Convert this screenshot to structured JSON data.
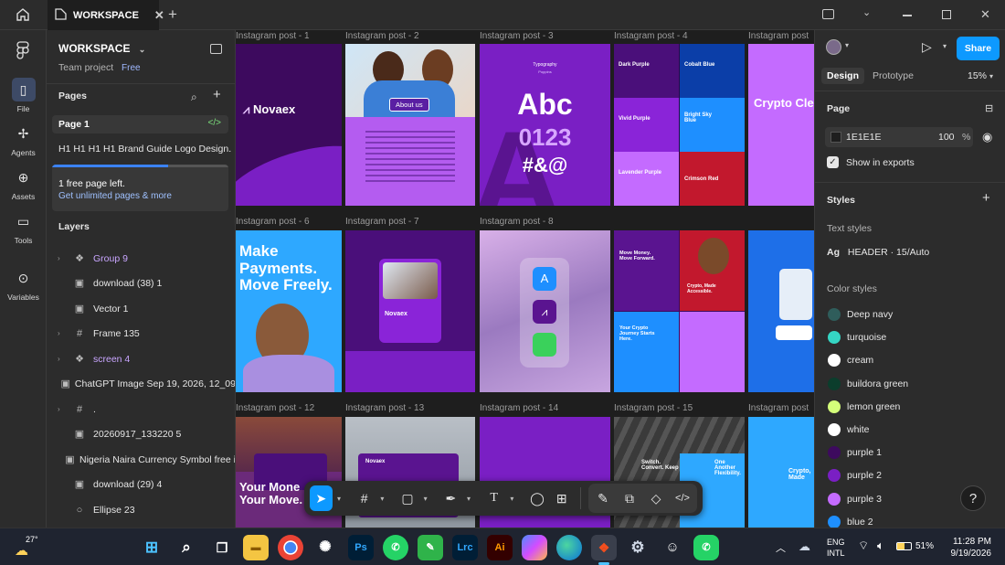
{
  "titlebar": {
    "tab_title": "WORKSPACE",
    "new_tab_symbol": "+"
  },
  "rail": {
    "items": [
      {
        "label": "File",
        "icon": "file-icon"
      },
      {
        "label": "Agents",
        "icon": "agents-icon"
      },
      {
        "label": "Assets",
        "icon": "assets-icon"
      },
      {
        "label": "Tools",
        "icon": "tools-icon"
      },
      {
        "label": "Variables",
        "icon": "variables-icon"
      }
    ]
  },
  "left_panel": {
    "workspace_name": "WORKSPACE",
    "team_project": "Team project",
    "plan_badge": "Free",
    "pages_heading": "Pages",
    "page_1": "Page 1",
    "page_2": "H1 H1 H1 H1 Brand Guide Logo Design...",
    "upsell_title": "1 free page left.",
    "upsell_link": "Get unlimited pages & more",
    "layers_heading": "Layers",
    "layers": [
      {
        "name": "Group 9",
        "type": "component"
      },
      {
        "name": "download (38) 1",
        "type": "image"
      },
      {
        "name": "Vector 1",
        "type": "image"
      },
      {
        "name": "Frame 135",
        "type": "frame"
      },
      {
        "name": "screen 4",
        "type": "component"
      },
      {
        "name": "ChatGPT Image Sep 19, 2026, 12_09",
        "type": "image"
      },
      {
        "name": ".",
        "type": "frame"
      },
      {
        "name": "20260917_133220 5",
        "type": "image"
      },
      {
        "name": "Nigeria Naira Currency Symbol free i",
        "type": "image"
      },
      {
        "name": "download (29) 4",
        "type": "image"
      },
      {
        "name": "Ellipse 23",
        "type": "ellipse"
      }
    ]
  },
  "canvas": {
    "frame_labels": [
      "Instagram post - 1",
      "Instagram post - 2",
      "Instagram post - 3",
      "Instagram post - 4",
      "Instagram post",
      "Instagram post - 6",
      "Instagram post - 7",
      "Instagram post - 8",
      "Instagram post - 12",
      "Instagram post - 13",
      "Instagram post - 14",
      "Instagram post - 15",
      "Instagram post"
    ],
    "post1": {
      "brand": "Novaex"
    },
    "post2": {
      "about": "About us"
    },
    "post3": {
      "kicker": "Typography",
      "sub": "Poppins",
      "big": "Abc",
      "digits": "0123",
      "symbols": "#&@"
    },
    "post4": {
      "c1": "Dark Purple",
      "c2": "Cobalt Blue",
      "c3": "Vivid Purple",
      "c4": "Bright Sky Blue",
      "c5": "Lavender Purple",
      "c6": "Crimson Red"
    },
    "post5": {
      "text": "Crypto Cle"
    },
    "post6": {
      "headline": "Make Payments. Move Freely."
    },
    "post7": {
      "brand": "Novaex"
    },
    "post9": {
      "t1": "Move Money. Move Forward.",
      "t2": "Crypto, Made Accessible.",
      "t3": "Your Crypto Journey Starts Here."
    },
    "post12": {
      "headline": "Your Mone Your Move."
    },
    "post13": {
      "brand": "Novaex"
    },
    "post15": {
      "t1": "Switch. Convert. Keep",
      "t2": "One Another Flexibility."
    },
    "post16": {
      "text": "Crypto, Made"
    }
  },
  "right_panel": {
    "tab_design": "Design",
    "tab_prototype": "Prototype",
    "zoom": "15%",
    "share_label": "Share",
    "page_heading": "Page",
    "page_color": "1E1E1E",
    "page_opacity": "100",
    "percent": "%",
    "show_exports": "Show in exports",
    "styles_heading": "Styles",
    "text_styles_heading": "Text styles",
    "text_style_ag": "Ag",
    "text_style_name": "HEADER · 15/Auto",
    "color_styles_heading": "Color styles",
    "color_styles": [
      {
        "name": "Deep navy",
        "color": "#2f5d5b"
      },
      {
        "name": "turquoise",
        "color": "#35d6c4"
      },
      {
        "name": "cream",
        "color": "#ffffff"
      },
      {
        "name": "buildora green",
        "color": "#0b3d2c"
      },
      {
        "name": "lemon green",
        "color": "#d4ff7a"
      },
      {
        "name": "white",
        "color": "#ffffff"
      },
      {
        "name": "purple 1",
        "color": "#3d0a5e"
      },
      {
        "name": "purple 2",
        "color": "#7a1fc4"
      },
      {
        "name": "purple 3",
        "color": "#c46bff"
      },
      {
        "name": "blue 2",
        "color": "#1e8fff"
      }
    ],
    "help": "?"
  },
  "taskbar": {
    "temperature": "27°",
    "lang1": "ENG",
    "lang2": "INTL",
    "battery": "51%",
    "time": "11:28 PM",
    "date": "9/19/2026",
    "apps": [
      "Ps",
      "Lrc",
      "Ai"
    ]
  }
}
